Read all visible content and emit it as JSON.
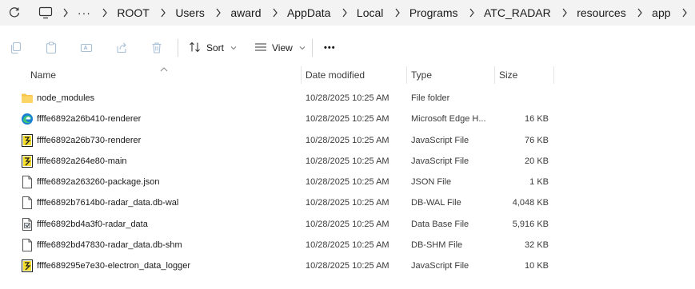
{
  "address": {
    "more": "···",
    "crumbs": [
      "ROOT",
      "Users",
      "award",
      "AppData",
      "Local",
      "Programs",
      "ATC_RADAR",
      "resources",
      "app"
    ]
  },
  "toolbar": {
    "sort_label": "Sort",
    "view_label": "View",
    "more_label": "•••"
  },
  "columns": {
    "name": "Name",
    "date": "Date modified",
    "type": "Type",
    "size": "Size"
  },
  "files": [
    {
      "icon": "folder-icon",
      "name": "node_modules",
      "date": "10/28/2025 10:25 AM",
      "type": "File folder",
      "size": ""
    },
    {
      "icon": "edge-icon",
      "name": "ffffe6892a26b410-renderer",
      "date": "10/28/2025 10:25 AM",
      "type": "Microsoft Edge H...",
      "size": "16 KB"
    },
    {
      "icon": "javascript-file-icon",
      "name": "ffffe6892a26b730-renderer",
      "date": "10/28/2025 10:25 AM",
      "type": "JavaScript File",
      "size": "76 KB"
    },
    {
      "icon": "javascript-file-icon",
      "name": "ffffe6892a264e80-main",
      "date": "10/28/2025 10:25 AM",
      "type": "JavaScript File",
      "size": "20 KB"
    },
    {
      "icon": "blank-file-icon",
      "name": "ffffe6892a263260-package.json",
      "date": "10/28/2025 10:25 AM",
      "type": "JSON File",
      "size": "1 KB"
    },
    {
      "icon": "blank-file-icon",
      "name": "ffffe6892b7614b0-radar_data.db-wal",
      "date": "10/28/2025 10:25 AM",
      "type": "DB-WAL File",
      "size": "4,048 KB"
    },
    {
      "icon": "database-file-icon",
      "name": "ffffe6892bd4a3f0-radar_data",
      "date": "10/28/2025 10:25 AM",
      "type": "Data Base File",
      "size": "5,916 KB"
    },
    {
      "icon": "blank-file-icon",
      "name": "ffffe6892bd47830-radar_data.db-shm",
      "date": "10/28/2025 10:25 AM",
      "type": "DB-SHM File",
      "size": "32 KB"
    },
    {
      "icon": "javascript-file-icon",
      "name": "ffffe689295e7e30-electron_data_logger",
      "date": "10/28/2025 10:25 AM",
      "type": "JavaScript File",
      "size": "10 KB"
    }
  ],
  "colors": {
    "folder": "#f8c54a",
    "edge": "#1a7fd4",
    "js_yellow": "#f5de2a",
    "toolbar_disabled": "#a9bfd6"
  }
}
